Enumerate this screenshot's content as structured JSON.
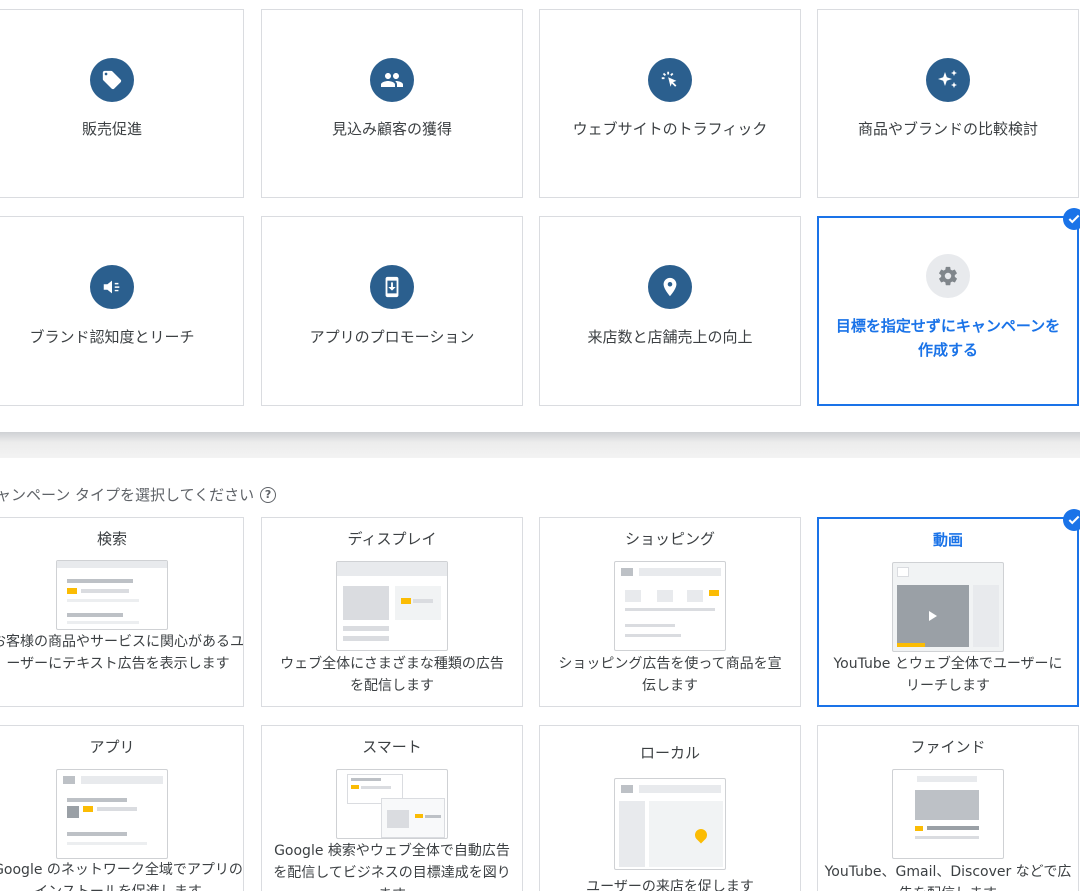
{
  "goals": [
    {
      "label": "販売促進",
      "icon": "tag-icon"
    },
    {
      "label": "見込み顧客の獲得",
      "icon": "people-icon"
    },
    {
      "label": "ウェブサイトのトラフィック",
      "icon": "cursor-click-icon"
    },
    {
      "label": "商品やブランドの比較検討",
      "icon": "sparkle-icon"
    },
    {
      "label": "ブランド認知度とリーチ",
      "icon": "megaphone-icon"
    },
    {
      "label": "アプリのプロモーション",
      "icon": "mobile-download-icon"
    },
    {
      "label": "来店数と店舗売上の向上",
      "icon": "location-pin-icon"
    },
    {
      "label": "目標を指定せずにキャンペーンを作成する",
      "icon": "gear-icon",
      "selected": true
    }
  ],
  "campaign_section": {
    "label": "ャンペーン タイプを選択してください",
    "help_icon": "help-icon"
  },
  "campaign_types": [
    {
      "title": "検索",
      "desc": "お客様の商品やサービスに関心があるユーザーにテキスト広告を表示します"
    },
    {
      "title": "ディスプレイ",
      "desc": "ウェブ全体にさまざまな種類の広告を配信します"
    },
    {
      "title": "ショッピング",
      "desc": "ショッピング広告を使って商品を宣伝します"
    },
    {
      "title": "動画",
      "desc": "YouTube とウェブ全体でユーザーにリーチします",
      "selected": true
    },
    {
      "title": "アプリ",
      "desc": "Google のネットワーク全域でアプリのインストールを促進します"
    },
    {
      "title": "スマート",
      "desc": "Google 検索やウェブ全体で自動広告を配信してビジネスの目標達成を図ります"
    },
    {
      "title": "ローカル",
      "desc": "ユーザーの来店を促します"
    },
    {
      "title": "ファインド",
      "desc": "YouTube、Gmail、Discover などで広告を配信します"
    }
  ],
  "colors": {
    "accent": "#1a73e8",
    "icon_bg": "#2b5f8e",
    "border": "#dadce0",
    "highlight": "#fbbc04"
  }
}
